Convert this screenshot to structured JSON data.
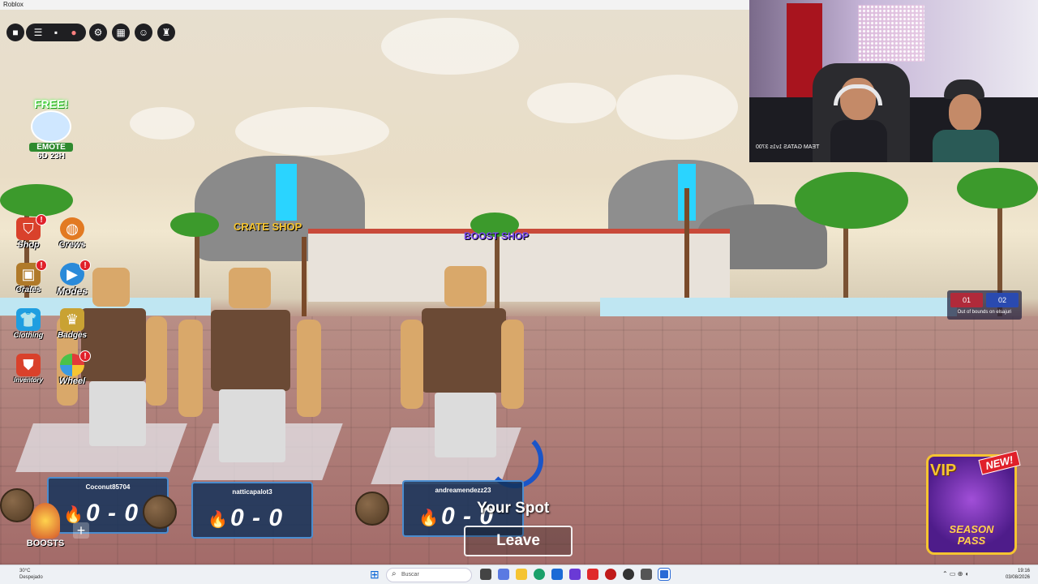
{
  "window": {
    "title": "Roblox"
  },
  "topbar": {
    "icons": [
      "roblox-logo-icon",
      "menu-icon",
      "chat-icon",
      "mic-icon",
      "settings-icon",
      "calendar-icon",
      "emote-icon",
      "walk-icon"
    ]
  },
  "free_emote": {
    "free": "FREE!",
    "label": "EMOTE",
    "timer": "6D 23H"
  },
  "side_menu": [
    {
      "label": "Shop",
      "icon": "basket-icon",
      "badge": "!"
    },
    {
      "label": "Crews",
      "icon": "basketball-icon",
      "badge": ""
    },
    {
      "label": "Crates",
      "icon": "crate-icon",
      "badge": "!"
    },
    {
      "label": "Modes",
      "icon": "play-icon",
      "badge": "!"
    },
    {
      "label": "Clothing",
      "icon": "shirt-icon",
      "badge": ""
    },
    {
      "label": "Badges",
      "icon": "trophy-icon",
      "badge": ""
    },
    {
      "label": "Inventory",
      "icon": "backpack-icon",
      "badge": ""
    },
    {
      "label": "Wheel",
      "icon": "wheel-icon",
      "badge": "!"
    }
  ],
  "signs": {
    "crate_shop": "CRATE SHOP",
    "boost_shop": "BOOST SHOP"
  },
  "scoreboards": [
    {
      "player": "Coconut85704",
      "score": "0 - 0"
    },
    {
      "player": "natticapalot3",
      "score": "0 - 0"
    },
    {
      "player": "andreamendezz23",
      "score": "0 - 0"
    }
  ],
  "your_spot": "Your Spot",
  "leave_button": "Leave",
  "boosts": {
    "label": "BOOSTS",
    "plus": "+"
  },
  "season_pass": {
    "vip": "VIP",
    "new": "NEW!",
    "line1": "SEASON",
    "line2": "PASS"
  },
  "out_of_bounds": {
    "left": "01",
    "right": "02",
    "text": "Out of bounds on elsajuri"
  },
  "webcam": {
    "caption": "TEAM GATAS 1v1s 3700"
  },
  "taskbar": {
    "weather_temp": "30°C",
    "weather_desc": "Despejado",
    "search_placeholder": "Buscar",
    "time": "19:16",
    "date": "03/08/2026"
  },
  "colors": {
    "scoreboard_bg": "#14325a",
    "accent_green": "#2f8a2f",
    "badge_red": "#e0202a",
    "season_gold": "#f5c431"
  }
}
